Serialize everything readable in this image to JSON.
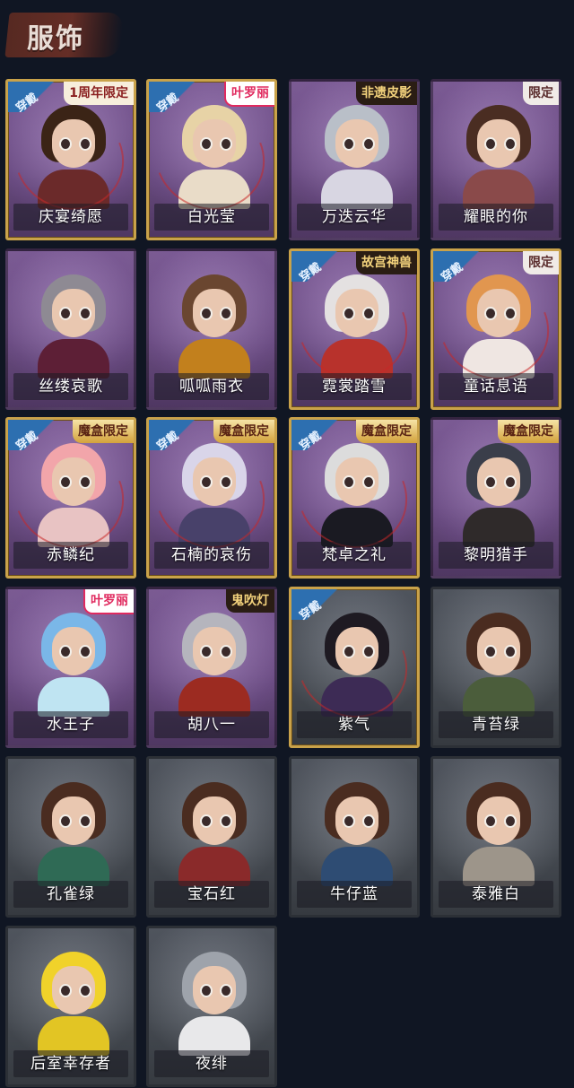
{
  "header": {
    "title": "服饰"
  },
  "wear_label": "穿戴",
  "cards": [
    {
      "name": "庆宴绮愿",
      "worn": true,
      "badge": "1周年限定",
      "badge_style": "cream-badge",
      "frame": "gold",
      "bg": "purple",
      "hair": "#3b2416",
      "outfit": "#6b2a2a"
    },
    {
      "name": "白光莹",
      "worn": true,
      "badge": "叶罗丽",
      "badge_style": "pink-badge",
      "frame": "gold",
      "bg": "purple",
      "hair": "#e7d3a6",
      "outfit": "#e9dcc8"
    },
    {
      "name": "万迭云华",
      "worn": false,
      "badge": "非遗皮影",
      "badge_style": "dark-badge",
      "frame": "plain",
      "bg": "purple",
      "hair": "#b9bfc8",
      "outfit": "#d8d6e2"
    },
    {
      "name": "耀眼的你",
      "worn": false,
      "badge": "限定",
      "badge_style": "white-badge",
      "frame": "plain",
      "bg": "purple",
      "hair": "#4a2d22",
      "outfit": "#8a4a4a"
    },
    {
      "name": "丝缕哀歌",
      "worn": false,
      "badge": "",
      "badge_style": "",
      "frame": "plain",
      "bg": "purple",
      "hair": "#8e8a93",
      "outfit": "#5d1f36"
    },
    {
      "name": "呱呱雨衣",
      "worn": false,
      "badge": "",
      "badge_style": "",
      "frame": "plain",
      "bg": "purple",
      "hair": "#6a4630",
      "outfit": "#c2801d"
    },
    {
      "name": "霓裳踏雪",
      "worn": true,
      "badge": "故宫神兽",
      "badge_style": "dark-badge",
      "frame": "gold",
      "bg": "purple",
      "hair": "#e4e1e1",
      "outfit": "#b8322c"
    },
    {
      "name": "童话息语",
      "worn": true,
      "badge": "限定",
      "badge_style": "white-badge",
      "frame": "gold",
      "bg": "purple",
      "hair": "#e1964f",
      "outfit": "#efe6e2"
    },
    {
      "name": "赤鳞纪",
      "worn": true,
      "badge": "魔盒限定",
      "badge_style": "gold-badge",
      "frame": "gold",
      "bg": "purple",
      "hair": "#f2a5aa",
      "outfit": "#e8c3c3"
    },
    {
      "name": "石楠的哀伤",
      "worn": true,
      "badge": "魔盒限定",
      "badge_style": "gold-badge",
      "frame": "gold",
      "bg": "purple",
      "hair": "#d9d5e9",
      "outfit": "#48416a"
    },
    {
      "name": "梵卓之礼",
      "worn": true,
      "badge": "魔盒限定",
      "badge_style": "gold-badge",
      "frame": "gold",
      "bg": "purple",
      "hair": "#dcdcdc",
      "outfit": "#1a1a22"
    },
    {
      "name": "黎明猎手",
      "worn": false,
      "badge": "魔盒限定",
      "badge_style": "gold-badge",
      "frame": "plain",
      "bg": "purple",
      "hair": "#3a3e4a",
      "outfit": "#2f2a2a"
    },
    {
      "name": "水王子",
      "worn": false,
      "badge": "叶罗丽",
      "badge_style": "pink-badge",
      "frame": "plain",
      "bg": "purple",
      "hair": "#7ab7e8",
      "outfit": "#bfe4f2"
    },
    {
      "name": "胡八一",
      "worn": false,
      "badge": "鬼吹灯",
      "badge_style": "dark-badge",
      "frame": "plain",
      "bg": "purple",
      "hair": "#b5b5bd",
      "outfit": "#9c2b21"
    },
    {
      "name": "紫气",
      "worn": true,
      "badge": "",
      "badge_style": "",
      "frame": "gold",
      "bg": "gray",
      "hair": "#1e1a22",
      "outfit": "#3d2b55"
    },
    {
      "name": "青苔绿",
      "worn": false,
      "badge": "",
      "badge_style": "",
      "frame": "plain",
      "bg": "gray",
      "hair": "#4a2c20",
      "outfit": "#4b5d3b"
    },
    {
      "name": "孔雀绿",
      "worn": false,
      "badge": "",
      "badge_style": "",
      "frame": "plain",
      "bg": "gray",
      "hair": "#4a2c20",
      "outfit": "#2f6a55"
    },
    {
      "name": "宝石红",
      "worn": false,
      "badge": "",
      "badge_style": "",
      "frame": "plain",
      "bg": "gray",
      "hair": "#4a2c20",
      "outfit": "#8a2a2a"
    },
    {
      "name": "牛仔蓝",
      "worn": false,
      "badge": "",
      "badge_style": "",
      "frame": "plain",
      "bg": "gray",
      "hair": "#4a2c20",
      "outfit": "#2e4c73"
    },
    {
      "name": "泰雅白",
      "worn": false,
      "badge": "",
      "badge_style": "",
      "frame": "plain",
      "bg": "gray",
      "hair": "#4a2c20",
      "outfit": "#9d958a"
    },
    {
      "name": "后室幸存者",
      "worn": false,
      "badge": "",
      "badge_style": "",
      "frame": "plain",
      "bg": "gray",
      "hair": "#f0d22a",
      "outfit": "#e2c524"
    },
    {
      "name": "夜绯",
      "worn": false,
      "badge": "",
      "badge_style": "",
      "frame": "plain",
      "bg": "gray",
      "hair": "#9ea3ab",
      "outfit": "#e8e8ea"
    }
  ]
}
